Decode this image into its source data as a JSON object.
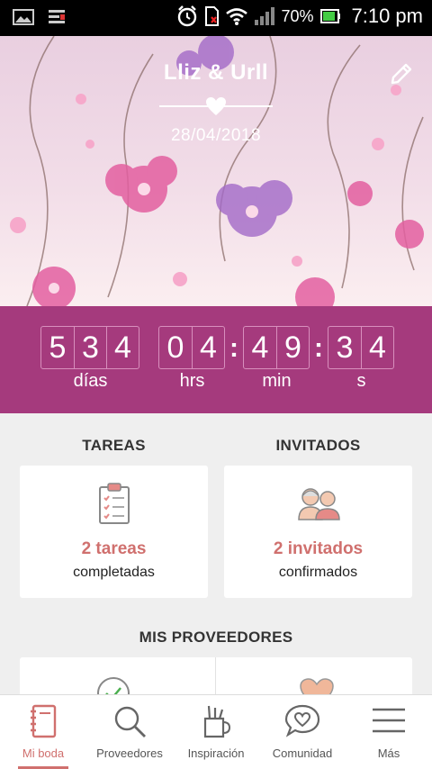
{
  "status_bar": {
    "battery": "70%",
    "time": "7:10 pm"
  },
  "hero": {
    "couple": "Lliz & Urll",
    "date": "28/04/2018"
  },
  "countdown": {
    "days": [
      "5",
      "3",
      "4"
    ],
    "hours": [
      "0",
      "4"
    ],
    "minutes": [
      "4",
      "9"
    ],
    "seconds": [
      "3",
      "4"
    ],
    "labels": {
      "days": "días",
      "hours": "hrs",
      "minutes": "min",
      "seconds": "s"
    }
  },
  "tasks": {
    "title": "TAREAS",
    "count": "2 tareas",
    "subtitle": "completadas"
  },
  "guests": {
    "title": "INVITADOS",
    "count": "2 invitados",
    "subtitle": "confirmados"
  },
  "vendors": {
    "title": "MIS PROVEEDORES"
  },
  "nav": {
    "items": [
      {
        "label": "Mi boda",
        "icon": "notebook-icon"
      },
      {
        "label": "Proveedores",
        "icon": "search-icon"
      },
      {
        "label": "Inspiración",
        "icon": "pencil-cup-icon"
      },
      {
        "label": "Comunidad",
        "icon": "chat-heart-icon"
      },
      {
        "label": "Más",
        "icon": "menu-icon"
      }
    ]
  },
  "colors": {
    "accent": "#a53a7d",
    "highlight": "#d0706e"
  }
}
